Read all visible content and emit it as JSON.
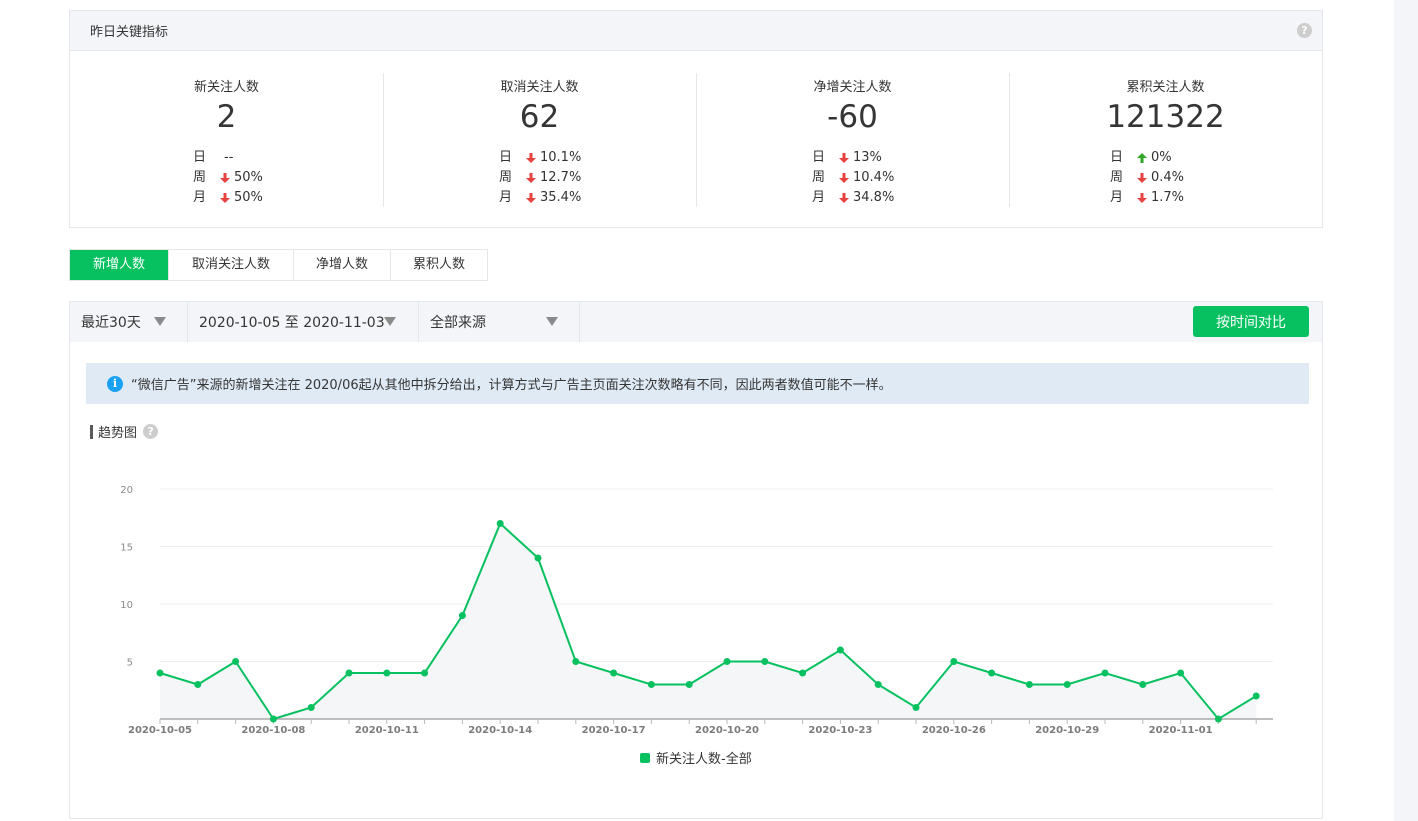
{
  "key_metrics": {
    "title": "昨日关键指标",
    "help": "?",
    "items": [
      {
        "name": "新关注人数",
        "value": "2",
        "rows": [
          {
            "label": "日",
            "dir": "none",
            "text": "--"
          },
          {
            "label": "周",
            "dir": "down",
            "text": "50%"
          },
          {
            "label": "月",
            "dir": "down",
            "text": "50%"
          }
        ]
      },
      {
        "name": "取消关注人数",
        "value": "62",
        "rows": [
          {
            "label": "日",
            "dir": "down",
            "text": "10.1%"
          },
          {
            "label": "周",
            "dir": "down",
            "text": "12.7%"
          },
          {
            "label": "月",
            "dir": "down",
            "text": "35.4%"
          }
        ]
      },
      {
        "name": "净增关注人数",
        "value": "-60",
        "rows": [
          {
            "label": "日",
            "dir": "down",
            "text": "13%"
          },
          {
            "label": "周",
            "dir": "down",
            "text": "10.4%"
          },
          {
            "label": "月",
            "dir": "down",
            "text": "34.8%"
          }
        ]
      },
      {
        "name": "累积关注人数",
        "value": "121322",
        "rows": [
          {
            "label": "日",
            "dir": "up",
            "text": "0%"
          },
          {
            "label": "周",
            "dir": "down",
            "text": "0.4%"
          },
          {
            "label": "月",
            "dir": "down",
            "text": "1.7%"
          }
        ]
      }
    ]
  },
  "tabs": [
    {
      "label": "新增人数",
      "active": true
    },
    {
      "label": "取消关注人数",
      "active": false
    },
    {
      "label": "净增人数",
      "active": false
    },
    {
      "label": "累积人数",
      "active": false
    }
  ],
  "filters": {
    "period": "最近30天",
    "range": "2020-10-05 至 2020-11-03",
    "source": "全部来源",
    "compare_button": "按时间对比"
  },
  "notice": {
    "icon": "i",
    "text": "“微信广告”来源的新增关注在 2020/06起从其他中拆分给出，计算方式与广告主页面关注次数略有不同，因此两者数值可能不一样。"
  },
  "trend_title": "趋势图",
  "colors": {
    "accent": "#07c160",
    "down": "#e64340",
    "up": "#2fa626"
  },
  "chart_data": {
    "type": "area",
    "x": [
      "2020-10-05",
      "2020-10-06",
      "2020-10-07",
      "2020-10-08",
      "2020-10-09",
      "2020-10-10",
      "2020-10-11",
      "2020-10-12",
      "2020-10-13",
      "2020-10-14",
      "2020-10-15",
      "2020-10-16",
      "2020-10-17",
      "2020-10-18",
      "2020-10-19",
      "2020-10-20",
      "2020-10-21",
      "2020-10-22",
      "2020-10-23",
      "2020-10-24",
      "2020-10-25",
      "2020-10-26",
      "2020-10-27",
      "2020-10-28",
      "2020-10-29",
      "2020-10-30",
      "2020-10-31",
      "2020-11-01",
      "2020-11-02",
      "2020-11-03"
    ],
    "xticks": [
      "2020-10-05",
      "2020-10-08",
      "2020-10-11",
      "2020-10-14",
      "2020-10-17",
      "2020-10-20",
      "2020-10-23",
      "2020-10-26",
      "2020-10-29",
      "2020-11-01"
    ],
    "yticks": [
      20,
      15,
      10,
      5
    ],
    "ylim": [
      0,
      20
    ],
    "grid": true,
    "legend": "bottom",
    "series": [
      {
        "name": "新关注人数-全部",
        "values": [
          4,
          3,
          5,
          0,
          1,
          4,
          4,
          4,
          9,
          17,
          14,
          5,
          4,
          3,
          3,
          5,
          5,
          4,
          6,
          3,
          1,
          5,
          4,
          3,
          3,
          4,
          3,
          4,
          0,
          2
        ]
      }
    ]
  }
}
